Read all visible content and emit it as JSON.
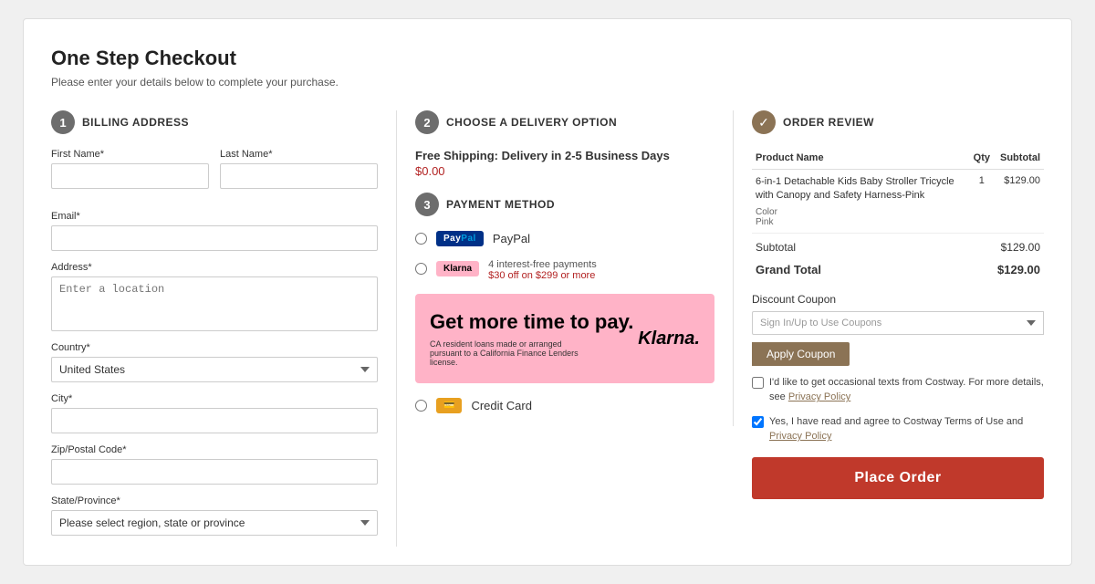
{
  "page": {
    "title": "One Step Checkout",
    "subtitle": "Please enter your details below to complete your purchase."
  },
  "billing": {
    "section_number": "1",
    "section_title": "BILLING ADDRESS",
    "first_name_label": "First Name*",
    "last_name_label": "Last Name*",
    "email_label": "Email*",
    "address_label": "Address*",
    "address_placeholder": "Enter a location",
    "country_label": "Country*",
    "country_value": "United States",
    "city_label": "City*",
    "zip_label": "Zip/Postal Code*",
    "state_label": "State/Province*",
    "state_placeholder": "Please select region, state or province"
  },
  "delivery": {
    "section_number": "2",
    "section_title": "CHOOSE A DELIVERY OPTION",
    "free_shipping_label": "Free Shipping: Delivery in 2-5 Business Days",
    "free_shipping_price": "$0.00",
    "payment_section_number": "3",
    "payment_section_title": "PAYMENT METHOD",
    "paypal_label": "PayPal",
    "klarna_installment": "4 interest-free payments",
    "klarna_discount": "$30 off on $299 or more",
    "klarna_banner_text": "Get more time to pay.",
    "klarna_banner_sub": "CA resident loans made or arranged pursuant to a California Finance Lenders license.",
    "klarna_logo": "Klarna.",
    "credit_card_label": "Credit Card"
  },
  "order_review": {
    "section_title": "ORDER REVIEW",
    "col_product": "Product Name",
    "col_qty": "Qty",
    "col_subtotal": "Subtotal",
    "product_name": "6-in-1 Detachable Kids Baby Stroller Tricycle with Canopy and Safety Harness-Pink",
    "product_color_label": "Color",
    "product_color_value": "Pink",
    "product_qty": "1",
    "product_price": "$129.00",
    "subtotal_label": "Subtotal",
    "subtotal_value": "$129.00",
    "grand_total_label": "Grand Total",
    "grand_total_value": "$129.00",
    "discount_label": "Discount Coupon",
    "coupon_placeholder": "Sign In/Up to Use Coupons",
    "apply_coupon_label": "Apply Coupon",
    "checkbox1_text": "I'd like to get occasional texts from Costway. For more details, see",
    "checkbox1_link": "Privacy Policy",
    "checkbox2_text": "Yes, I have read and agree to Costway Terms of Use and",
    "checkbox2_link": "Privacy Policy",
    "place_order_label": "Place Order"
  }
}
